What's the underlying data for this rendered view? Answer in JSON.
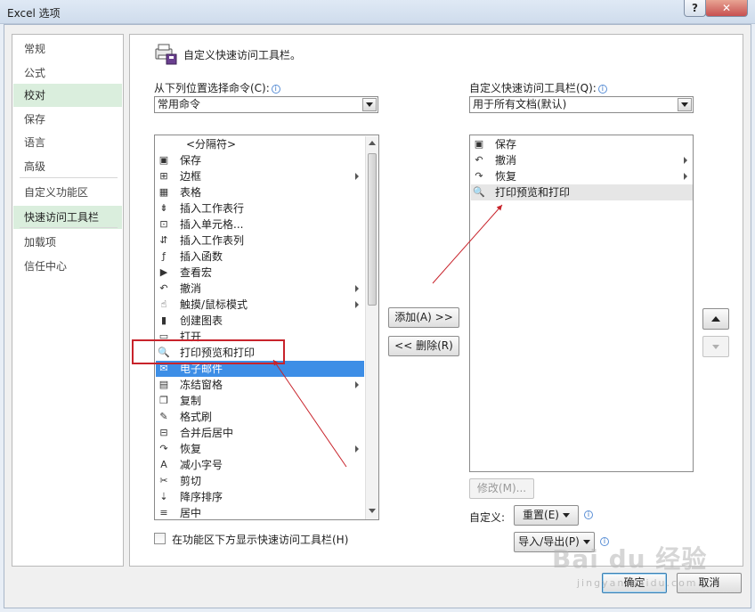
{
  "window": {
    "title": "Excel 选项",
    "help": "?",
    "close": "✕"
  },
  "nav": {
    "items": [
      {
        "label": "常规",
        "active": false
      },
      {
        "label": "公式",
        "active": false
      },
      {
        "label": "校对",
        "active": true
      },
      {
        "label": "保存",
        "active": false
      },
      {
        "label": "语言",
        "active": false
      },
      {
        "label": "高级",
        "active": false
      },
      {
        "label": "自定义功能区",
        "active": false
      },
      {
        "label": "快速访问工具栏",
        "active": true
      },
      {
        "label": "加载项",
        "active": false
      },
      {
        "label": "信任中心",
        "active": false
      }
    ]
  },
  "header": {
    "title": "自定义快速访问工具栏。"
  },
  "left": {
    "label": "从下列位置选择命令(C):",
    "combo_value": "常用命令",
    "commands": [
      {
        "label": "<分隔符>",
        "icon": "separator",
        "submenu": false
      },
      {
        "label": "保存",
        "icon": "save-icon",
        "submenu": false
      },
      {
        "label": "边框",
        "icon": "border-icon",
        "submenu": true
      },
      {
        "label": "表格",
        "icon": "table-icon",
        "submenu": false
      },
      {
        "label": "插入工作表行",
        "icon": "insert-row-icon",
        "submenu": false
      },
      {
        "label": "插入单元格...",
        "icon": "insert-cell-icon",
        "submenu": false
      },
      {
        "label": "插入工作表列",
        "icon": "insert-column-icon",
        "submenu": false
      },
      {
        "label": "插入函数",
        "icon": "function-icon",
        "submenu": false
      },
      {
        "label": "查看宏",
        "icon": "macro-icon",
        "submenu": false
      },
      {
        "label": "撤消",
        "icon": "undo-icon",
        "submenu": true
      },
      {
        "label": "触摸/鼠标模式",
        "icon": "touch-icon",
        "submenu": true
      },
      {
        "label": "创建图表",
        "icon": "chart-icon",
        "submenu": false
      },
      {
        "label": "打开",
        "icon": "open-icon",
        "submenu": false
      },
      {
        "label": "打印预览和打印",
        "icon": "print-preview-icon",
        "submenu": false
      },
      {
        "label": "电子邮件",
        "icon": "email-icon",
        "submenu": false
      },
      {
        "label": "冻结窗格",
        "icon": "freeze-icon",
        "submenu": true
      },
      {
        "label": "复制",
        "icon": "copy-icon",
        "submenu": false
      },
      {
        "label": "格式刷",
        "icon": "format-painter-icon",
        "submenu": false
      },
      {
        "label": "合并后居中",
        "icon": "merge-icon",
        "submenu": false
      },
      {
        "label": "恢复",
        "icon": "redo-icon",
        "submenu": true
      },
      {
        "label": "减小字号",
        "icon": "font-smaller-icon",
        "submenu": false
      },
      {
        "label": "剪切",
        "icon": "cut-icon",
        "submenu": false
      },
      {
        "label": "降序排序",
        "icon": "sort-desc-icon",
        "submenu": false
      },
      {
        "label": "居中",
        "icon": "center-icon",
        "submenu": false
      }
    ],
    "selected_index": 14,
    "show_below_ribbon_label": "在功能区下方显示快速访问工具栏(H)"
  },
  "right": {
    "label": "自定义快速访问工具栏(Q):",
    "combo_value": "用于所有文档(默认)",
    "commands": [
      {
        "label": "保存",
        "icon": "save-icon",
        "submenu": false
      },
      {
        "label": "撤消",
        "icon": "undo-icon",
        "submenu": true
      },
      {
        "label": "恢复",
        "icon": "redo-icon",
        "submenu": true
      },
      {
        "label": "打印预览和打印",
        "icon": "print-preview-icon",
        "submenu": false
      }
    ],
    "highlight_index": 3,
    "modify_button": "修改(M)...",
    "custom_label": "自定义:",
    "reset_button": "重置(E)",
    "import_export_button": "导入/导出(P)"
  },
  "middle": {
    "add_button": "添加(A) >>",
    "remove_button": "<< 删除(R)"
  },
  "footer": {
    "ok": "确定",
    "cancel": "取消"
  },
  "watermark": {
    "brand": "Bai du 经验",
    "sub": "jingyan.baidu.com"
  },
  "colors": {
    "selection": "#3d8ee6",
    "nav_active": "#daeedd",
    "annotation_red": "#c8232b"
  }
}
